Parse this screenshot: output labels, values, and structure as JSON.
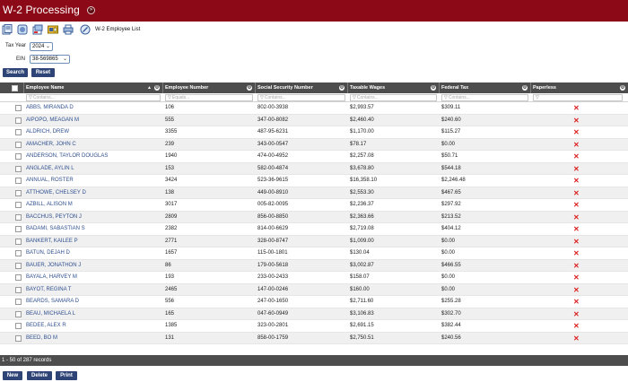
{
  "app": {
    "title": "W-2 Processing",
    "title_arrow": "»"
  },
  "toolbar": {
    "icons": [
      "print-report-icon",
      "print-forms-icon",
      "export-icon",
      "efile-icon",
      "print-icon",
      "w2-list-icon"
    ],
    "list_label": "W-2 Employee List"
  },
  "filters": {
    "tax_year_label": "Tax Year",
    "tax_year_value": "2024",
    "ein_label": "EIN",
    "ein_value": "38-569865"
  },
  "buttons": {
    "search": "Search",
    "reset": "Reset",
    "new": "New",
    "delete": "Delete",
    "print": "Print"
  },
  "grid": {
    "columns": [
      {
        "label": "Employee Name",
        "filter": "Contains..."
      },
      {
        "label": "Employee Number",
        "filter": "Equals..."
      },
      {
        "label": "Social Security Number",
        "filter": "Contains..."
      },
      {
        "label": "Taxable Wages",
        "filter": "Contains..."
      },
      {
        "label": "Federal Tax",
        "filter": "Contains..."
      },
      {
        "label": "Paperless",
        "filter": ""
      }
    ],
    "rows": [
      {
        "name": "ABBS, MIRANDA D",
        "num": "106",
        "ssn": "802-00-3938",
        "wages": "$2,993.57",
        "fed": "$309.11"
      },
      {
        "name": "AIPOPO, MEAGAN M",
        "num": "555",
        "ssn": "347-00-8082",
        "wages": "$2,460.40",
        "fed": "$240.60"
      },
      {
        "name": "ALDRICH, DREW",
        "num": "3355",
        "ssn": "487-95-6231",
        "wages": "$1,170.00",
        "fed": "$115.27"
      },
      {
        "name": "AMACHER, JOHN C",
        "num": "239",
        "ssn": "343-00-0547",
        "wages": "$78.17",
        "fed": "$0.00"
      },
      {
        "name": "ANDERSON, TAYLOR DOUGLAS",
        "num": "1940",
        "ssn": "474-00-4952",
        "wages": "$2,257.08",
        "fed": "$50.71"
      },
      {
        "name": "ANGLADE, AYLIN L",
        "num": "153",
        "ssn": "582-00-4874",
        "wages": "$3,678.80",
        "fed": "$544.18"
      },
      {
        "name": "ANNUAL, ROSTER",
        "num": "3424",
        "ssn": "523-36-9615",
        "wages": "$16,358.10",
        "fed": "$2,246.48"
      },
      {
        "name": "ATTHOWE, CHELSEY D",
        "num": "138",
        "ssn": "449-00-8910",
        "wages": "$2,553.30",
        "fed": "$467.65"
      },
      {
        "name": "AZBILL, ALISON M",
        "num": "3017",
        "ssn": "005-82-0095",
        "wages": "$2,236.37",
        "fed": "$297.92"
      },
      {
        "name": "BACCHUS, PEYTON J",
        "num": "2809",
        "ssn": "856-00-8850",
        "wages": "$2,363.66",
        "fed": "$213.52"
      },
      {
        "name": "BADAMI, SABASTIAN S",
        "num": "2382",
        "ssn": "814-00-6629",
        "wages": "$2,719.08",
        "fed": "$404.12"
      },
      {
        "name": "BANKERT, KAILEE P",
        "num": "2771",
        "ssn": "328-00-8747",
        "wages": "$1,009.00",
        "fed": "$0.00"
      },
      {
        "name": "BATUN, DEJAH D",
        "num": "1657",
        "ssn": "115-00-1801",
        "wages": "$130.04",
        "fed": "$0.00"
      },
      {
        "name": "BAUER, JONATHON J",
        "num": "86",
        "ssn": "179-00-5618",
        "wages": "$3,002.87",
        "fed": "$466.55"
      },
      {
        "name": "BAYALA, HARVEY M",
        "num": "193",
        "ssn": "233-00-2433",
        "wages": "$158.07",
        "fed": "$0.00"
      },
      {
        "name": "BAYOT, REGINA T",
        "num": "2465",
        "ssn": "147-00-0246",
        "wages": "$160.00",
        "fed": "$0.00"
      },
      {
        "name": "BEARDS, SAMARA D",
        "num": "556",
        "ssn": "247-00-1650",
        "wages": "$2,711.60",
        "fed": "$255.28"
      },
      {
        "name": "BEAU, MICHAELA L",
        "num": "165",
        "ssn": "047-60-0949",
        "wages": "$3,106.83",
        "fed": "$302.70"
      },
      {
        "name": "BEDEE, ALEX R",
        "num": "1385",
        "ssn": "323-00-2801",
        "wages": "$2,691.15",
        "fed": "$382.44"
      },
      {
        "name": "BEED, BO M",
        "num": "131",
        "ssn": "858-00-1759",
        "wages": "$2,750.51",
        "fed": "$240.56"
      },
      {
        "name": "",
        "num": "",
        "ssn": "",
        "wages": "",
        "fed": ""
      }
    ],
    "paperless_mark": "✕",
    "footer": "1 - 50 of 287 records"
  },
  "colors": {
    "brand": "#8c0a17",
    "button": "#2e4476",
    "header": "#4d4d4d",
    "link": "#2f4f8f",
    "paperless_x": "#dd2222"
  }
}
